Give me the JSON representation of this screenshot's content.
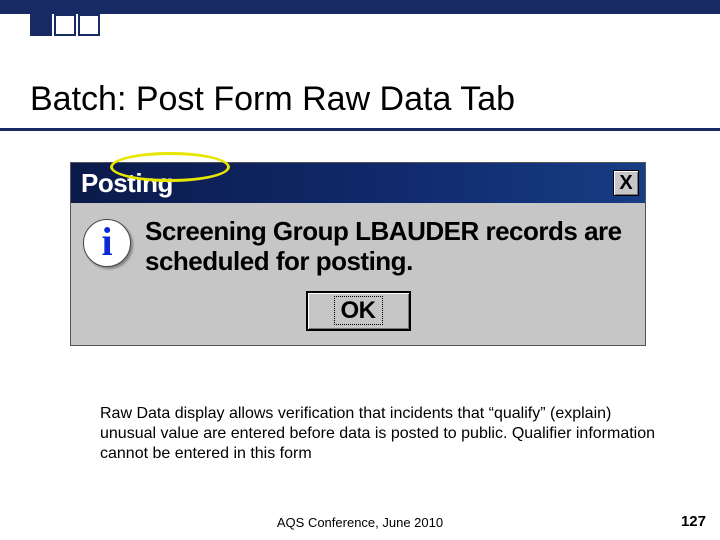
{
  "slide": {
    "title": "Batch: Post Form Raw Data Tab",
    "page_number": "127"
  },
  "dialog": {
    "titlebar": "Posting",
    "close_label": "X",
    "message": "Screening Group LBAUDER records are scheduled for posting.",
    "ok_label": "OK",
    "info_icon_letter": "i"
  },
  "note": "Raw Data display allows verification that incidents that “qualify” (explain) unusual value are entered before data is posted to public. Qualifier information cannot be entered in this form",
  "footer": {
    "conference": "AQS Conference, June 2010"
  }
}
